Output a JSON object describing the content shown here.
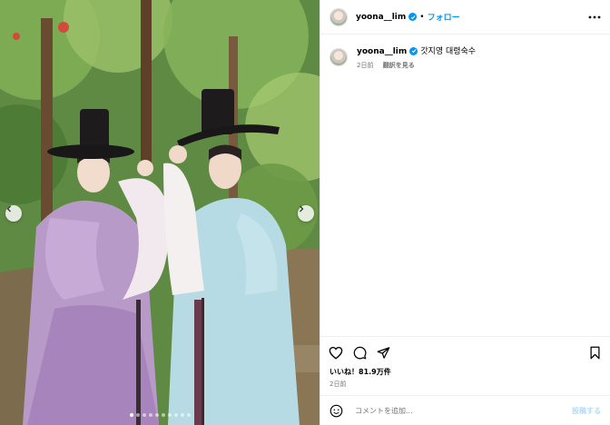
{
  "header": {
    "username": "yoona__lim",
    "separator": "•",
    "follow_label": "フォロー"
  },
  "caption": {
    "username": "yoona__lim",
    "text": "갓지영 대령숙수",
    "time_ago": "2日前",
    "translate_label": "翻訳を見る"
  },
  "engagement": {
    "likes": "いいね！81.9万件",
    "date": "2日前"
  },
  "comment": {
    "placeholder": "コメントを追加...",
    "post_label": "投稿する"
  },
  "carousel": {
    "slide_count": 10,
    "active_index": 0
  },
  "colors": {
    "accent": "#0095f6",
    "post_button_disabled": "#b3dbff",
    "secondary_text": "#737373"
  },
  "icons": {
    "verified": "verified-badge-icon",
    "more": "more-horizontal-icon",
    "like": "heart-icon",
    "comment": "comment-bubble-icon",
    "share": "paper-plane-icon",
    "save": "bookmark-icon",
    "emoji": "smiley-icon",
    "prev": "chevron-left-icon",
    "next": "chevron-right-icon"
  }
}
